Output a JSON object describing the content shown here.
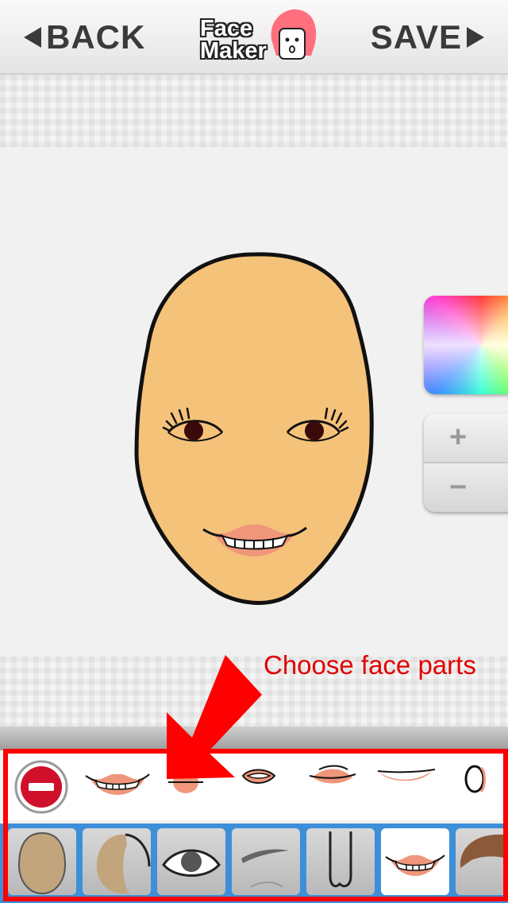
{
  "header": {
    "back_label": "BACK",
    "save_label": "SAVE",
    "logo_line1": "Face",
    "logo_line2": "Maker"
  },
  "tools": {
    "color_picker": "color-wheel",
    "zoom_in_label": "+",
    "zoom_out_label": "−"
  },
  "annotation": {
    "text": "Choose face parts"
  },
  "face": {
    "skin_color": "#f5c27a",
    "outline_color": "#111111"
  },
  "parts_row": {
    "items": [
      "remove-icon",
      "mouth-smile-teeth",
      "mouth-small-open",
      "mouth-open",
      "mouth-closed",
      "mouth-thin",
      "mouth-o"
    ]
  },
  "categories": {
    "items": [
      "face-shape",
      "face-side",
      "eye",
      "eyebrow",
      "nose",
      "mouth",
      "hair"
    ],
    "active": "mouth"
  },
  "colors": {
    "accent_red": "#ff0000",
    "category_bar": "#3d8fd9",
    "lip": "#f0967a"
  }
}
